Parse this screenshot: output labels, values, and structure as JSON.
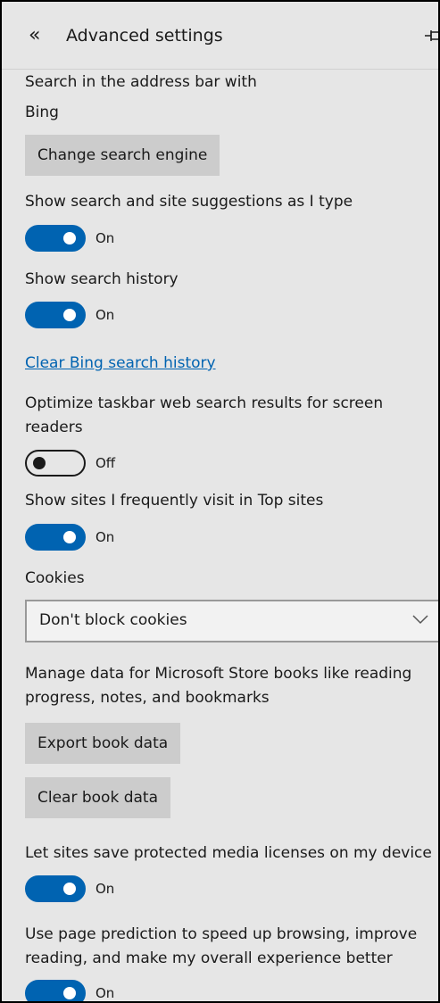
{
  "header": {
    "back_icon": "«",
    "title": "Advanced settings"
  },
  "search": {
    "label": "Search in the address bar with",
    "engine": "Bing",
    "change_button": "Change search engine"
  },
  "settings": {
    "suggestions": {
      "label": "Show search and site suggestions as I type",
      "state": "On"
    },
    "history": {
      "label": "Show search history",
      "state": "On"
    },
    "clear_history_link": "Clear Bing search history",
    "optimize": {
      "label_line1": "Optimize taskbar web search results for screen",
      "label_line2": "readers",
      "state": "Off"
    },
    "top_sites": {
      "label": "Show sites I frequently visit in Top sites",
      "state": "On"
    }
  },
  "cookies": {
    "label": "Cookies",
    "selected": "Don't block cookies"
  },
  "books": {
    "label_line1": "Manage data for Microsoft Store books like reading",
    "label_line2": "progress, notes, and bookmarks",
    "export_button": "Export book data",
    "clear_button": "Clear book data"
  },
  "media": {
    "label": "Let sites save protected media licenses on my device",
    "state": "On"
  },
  "prediction": {
    "label_line1": "Use page prediction to speed up browsing, improve",
    "label_line2": "reading, and make my overall experience better",
    "state": "On"
  },
  "colors": {
    "accent": "#0063b1",
    "panel": "#e6e6e6",
    "button": "#cccccc"
  }
}
